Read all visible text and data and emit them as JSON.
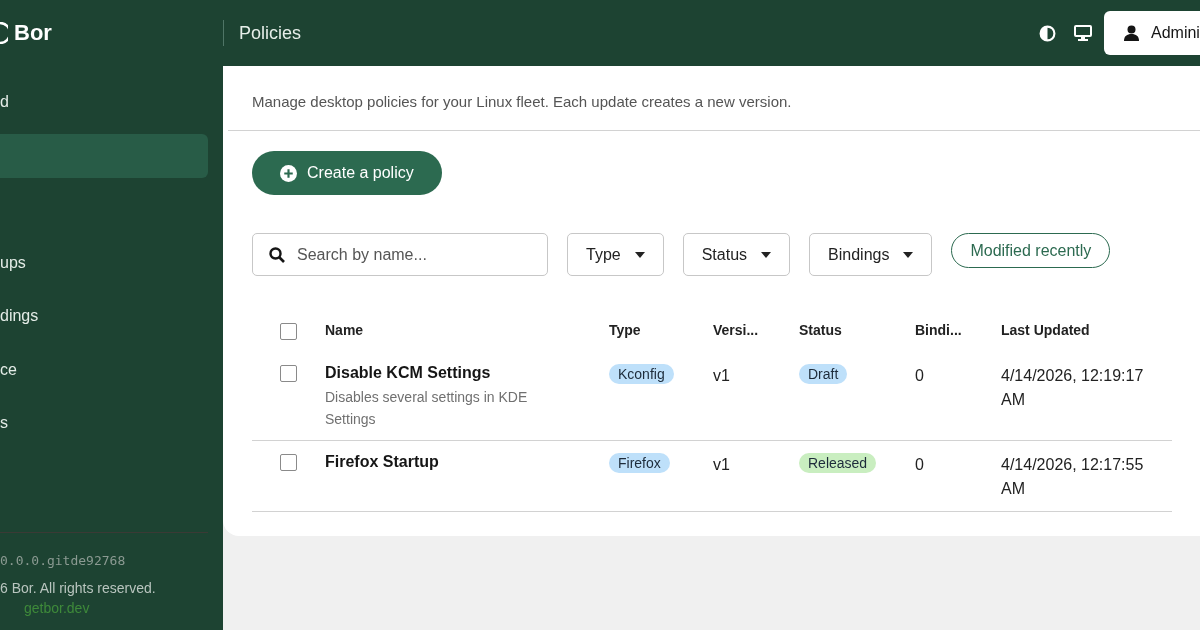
{
  "header": {
    "brand": "Bor",
    "page_title": "Policies",
    "user_button": "Admini"
  },
  "sidebar": {
    "items": [
      {
        "label": "d",
        "selected": false
      },
      {
        "selected": true
      },
      {
        "selected": false
      },
      {
        "label": "ups",
        "selected": false
      },
      {
        "label": "dings",
        "selected": false
      },
      {
        "label": "ce",
        "selected": false
      },
      {
        "label": "s",
        "selected": false
      }
    ],
    "version": "0.0.0.gitde92768",
    "copyright": "6 Bor. All rights reserved.",
    "link": "getbor.dev"
  },
  "description": "Manage desktop policies for your Linux fleet. Each update creates a new version.",
  "create_button": "Create a policy",
  "filters": {
    "search": {
      "placeholder": "Search by name..."
    },
    "dropdowns": [
      "Type",
      "Status",
      "Bindings"
    ],
    "chip": "Modified recently"
  },
  "table": {
    "header_checked": false,
    "columns": [
      "Name",
      "Type",
      "Versi...",
      "Status",
      "Bindi...",
      "Last Updated"
    ],
    "rows": [
      {
        "checked": false,
        "name": "Disable KCM Settings",
        "description": "Disables several settings in KDE Settings",
        "type": {
          "label": "Kconfig",
          "color": "#bee0fa"
        },
        "version": "v1",
        "status": {
          "label": "Draft",
          "color": "#bee0fa"
        },
        "bindings": "0",
        "updated": "4/14/2026, 12:19:17 AM"
      },
      {
        "checked": false,
        "name": "Firefox Startup",
        "type": {
          "label": "Firefox",
          "color": "#bee0fa"
        },
        "version": "v1",
        "status": {
          "label": "Released",
          "color": "#c9eec0"
        },
        "bindings": "0",
        "updated": "4/14/2026, 12:17:55 AM"
      }
    ]
  }
}
